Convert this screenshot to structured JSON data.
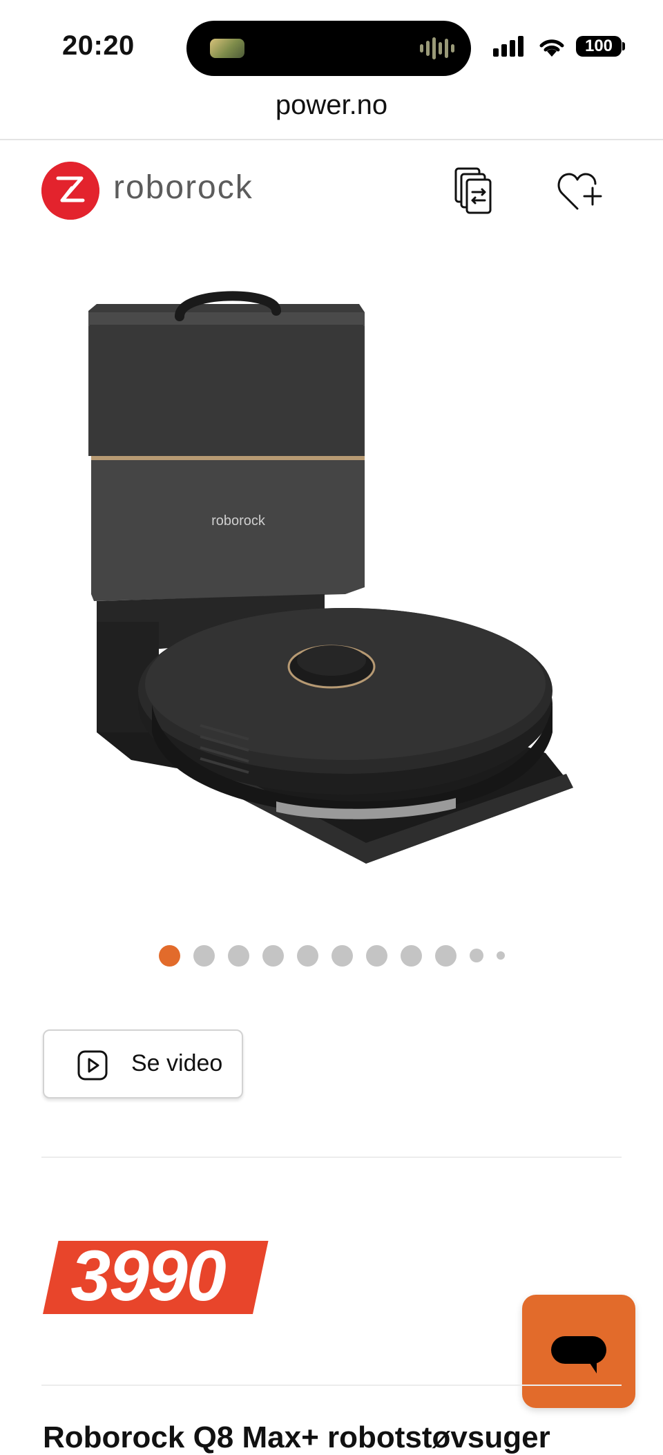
{
  "status_bar": {
    "time": "20:20",
    "battery": "100",
    "icons": [
      "signal-icon",
      "wifi-icon",
      "battery-icon"
    ]
  },
  "browser": {
    "url": "power.no"
  },
  "header": {
    "brand_name": "roborock",
    "compare_icon": "compare-icon",
    "favorite_icon": "heart-plus-icon"
  },
  "gallery": {
    "dot_count": 11,
    "active_index": 0,
    "active_color": "#e26b2b",
    "inactive_color": "#c4c4c4"
  },
  "video": {
    "label": "Se video",
    "icon": "play-icon"
  },
  "price": {
    "value": "3990",
    "badge_color": "#e8452b"
  },
  "chat": {
    "icon": "chat-bubble-icon",
    "color": "#e26b2b"
  },
  "product": {
    "title_partial": "Roborock Q8 Max+ robotstøvsuger"
  },
  "colors": {
    "brand_red": "#e3232d",
    "accent_orange": "#e26b2b"
  }
}
